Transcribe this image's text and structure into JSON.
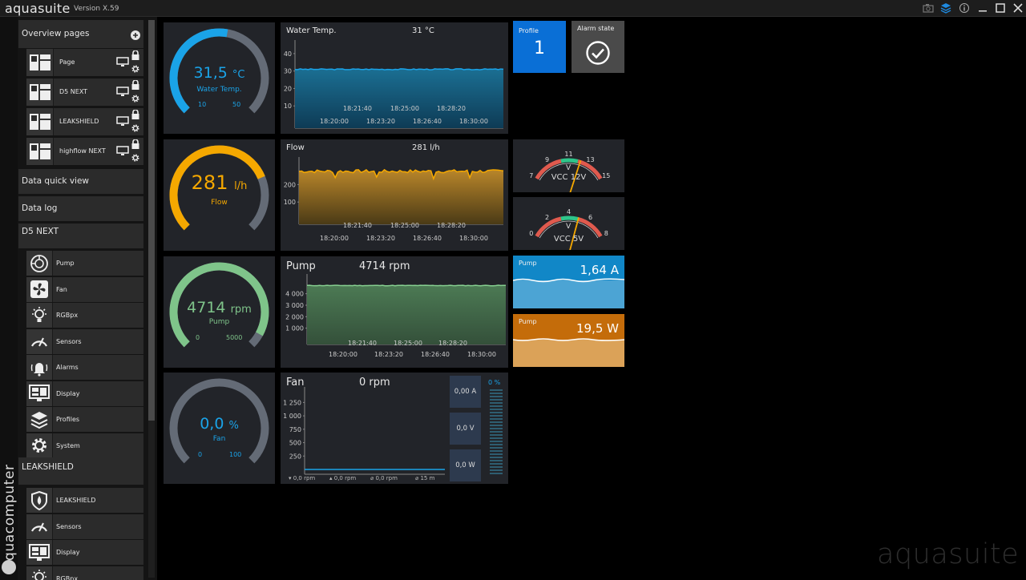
{
  "app": {
    "title": "aquasuite",
    "version": "Version X.59",
    "watermark": "aquasuite"
  },
  "brand": {
    "vertical": "aquacomputer"
  },
  "sidebar": {
    "overview_title": "Overview pages",
    "overview_pages": [
      {
        "label": "Page"
      },
      {
        "label": "D5 NEXT"
      },
      {
        "label": "LEAKSHIELD"
      },
      {
        "label": "highflow NEXT"
      }
    ],
    "data_quick_view": "Data quick view",
    "data_log": "Data log",
    "d5_title": "D5 NEXT",
    "d5_items": [
      {
        "label": "Pump"
      },
      {
        "label": "Fan"
      },
      {
        "label": "RGBpx"
      },
      {
        "label": "Sensors"
      },
      {
        "label": "Alarms"
      },
      {
        "label": "Display"
      },
      {
        "label": "Profiles"
      },
      {
        "label": "System"
      }
    ],
    "leak_title": "LEAKSHIELD",
    "leak_items": [
      {
        "label": "LEAKSHIELD"
      },
      {
        "label": "Sensors"
      },
      {
        "label": "Display"
      },
      {
        "label": "RGBpx"
      }
    ]
  },
  "gauges": {
    "water": {
      "value": "31,5",
      "unit": "°C",
      "label": "Water Temp.",
      "min": "10",
      "max": "50",
      "fraction": 0.5375,
      "color": "#1aa3e8"
    },
    "flow": {
      "value": "281",
      "unit": "l/h",
      "label": "Flow",
      "min": "",
      "max": "",
      "fraction": 0.75,
      "color": "#f5a800"
    },
    "pump": {
      "value": "4714",
      "unit": "rpm",
      "label": "Pump",
      "min": "0",
      "max": "5000",
      "fraction": 0.94,
      "color": "#7fc48a"
    },
    "fan": {
      "value": "0,0",
      "unit": "%",
      "label": "Fan",
      "min": "0",
      "max": "100",
      "fraction": 0,
      "color": "#1aa3e8"
    }
  },
  "charts": {
    "water": {
      "title": "Water Temp.",
      "value": "31 °C",
      "yticks": [
        "40",
        "30",
        "20",
        "10"
      ],
      "xticks_top": [
        "18:21:40",
        "18:25:00",
        "18:28:20"
      ],
      "xticks_bottom": [
        "18:20:00",
        "18:23:20",
        "18:26:40",
        "18:30:00"
      ]
    },
    "flow": {
      "title": "Flow",
      "value": "281 l/h",
      "yticks": [
        "200",
        "100"
      ],
      "xticks_top": [
        "18:21:40",
        "18:25:00",
        "18:28:20"
      ],
      "xticks_bottom": [
        "18:20:00",
        "18:23:20",
        "18:26:40",
        "18:30:00"
      ]
    },
    "pump": {
      "title": "Pump",
      "value": "4714 rpm",
      "yticks": [
        "4 000",
        "3 000",
        "2 000",
        "1 000"
      ],
      "xticks_top": [
        "18:21:40",
        "18:25:00",
        "18:28:20"
      ],
      "xticks_bottom": [
        "18:20:00",
        "18:23:20",
        "18:26:40",
        "18:30:00"
      ]
    },
    "fan": {
      "title": "Fan",
      "value": "0 rpm",
      "yticks": [
        "1 250",
        "1 000",
        "750",
        "500",
        "250"
      ],
      "legend": [
        "▾ 0,0 rpm",
        "▴ 0,0 rpm",
        "⌀ 0,0 rpm",
        "⌀ 15 m"
      ],
      "boxes": [
        "0,00 A",
        "0,0 V",
        "0,0 W"
      ],
      "bar_label": "0 %"
    }
  },
  "tiles": {
    "profile": {
      "label": "Profile",
      "value": "1",
      "color": "#0a6fd6"
    },
    "alarm": {
      "label": "Alarm state"
    },
    "vcc12": {
      "label": "VCC 12V",
      "unit": "V",
      "ticks": [
        "7",
        "9",
        "11",
        "13",
        "15"
      ],
      "value": 12.2,
      "min": 7,
      "max": 15
    },
    "vcc5": {
      "label": "VCC 5V",
      "unit": "V",
      "ticks": [
        "0",
        "2",
        "4",
        "6",
        "8"
      ],
      "value": 5.0,
      "min": 0,
      "max": 8
    },
    "pump_current": {
      "label": "Pump",
      "value": "1,64 A",
      "color": "#3aa3d6"
    },
    "pump_power": {
      "label": "Pump",
      "value": "19,5 W",
      "color": "#e08a1c"
    }
  }
}
